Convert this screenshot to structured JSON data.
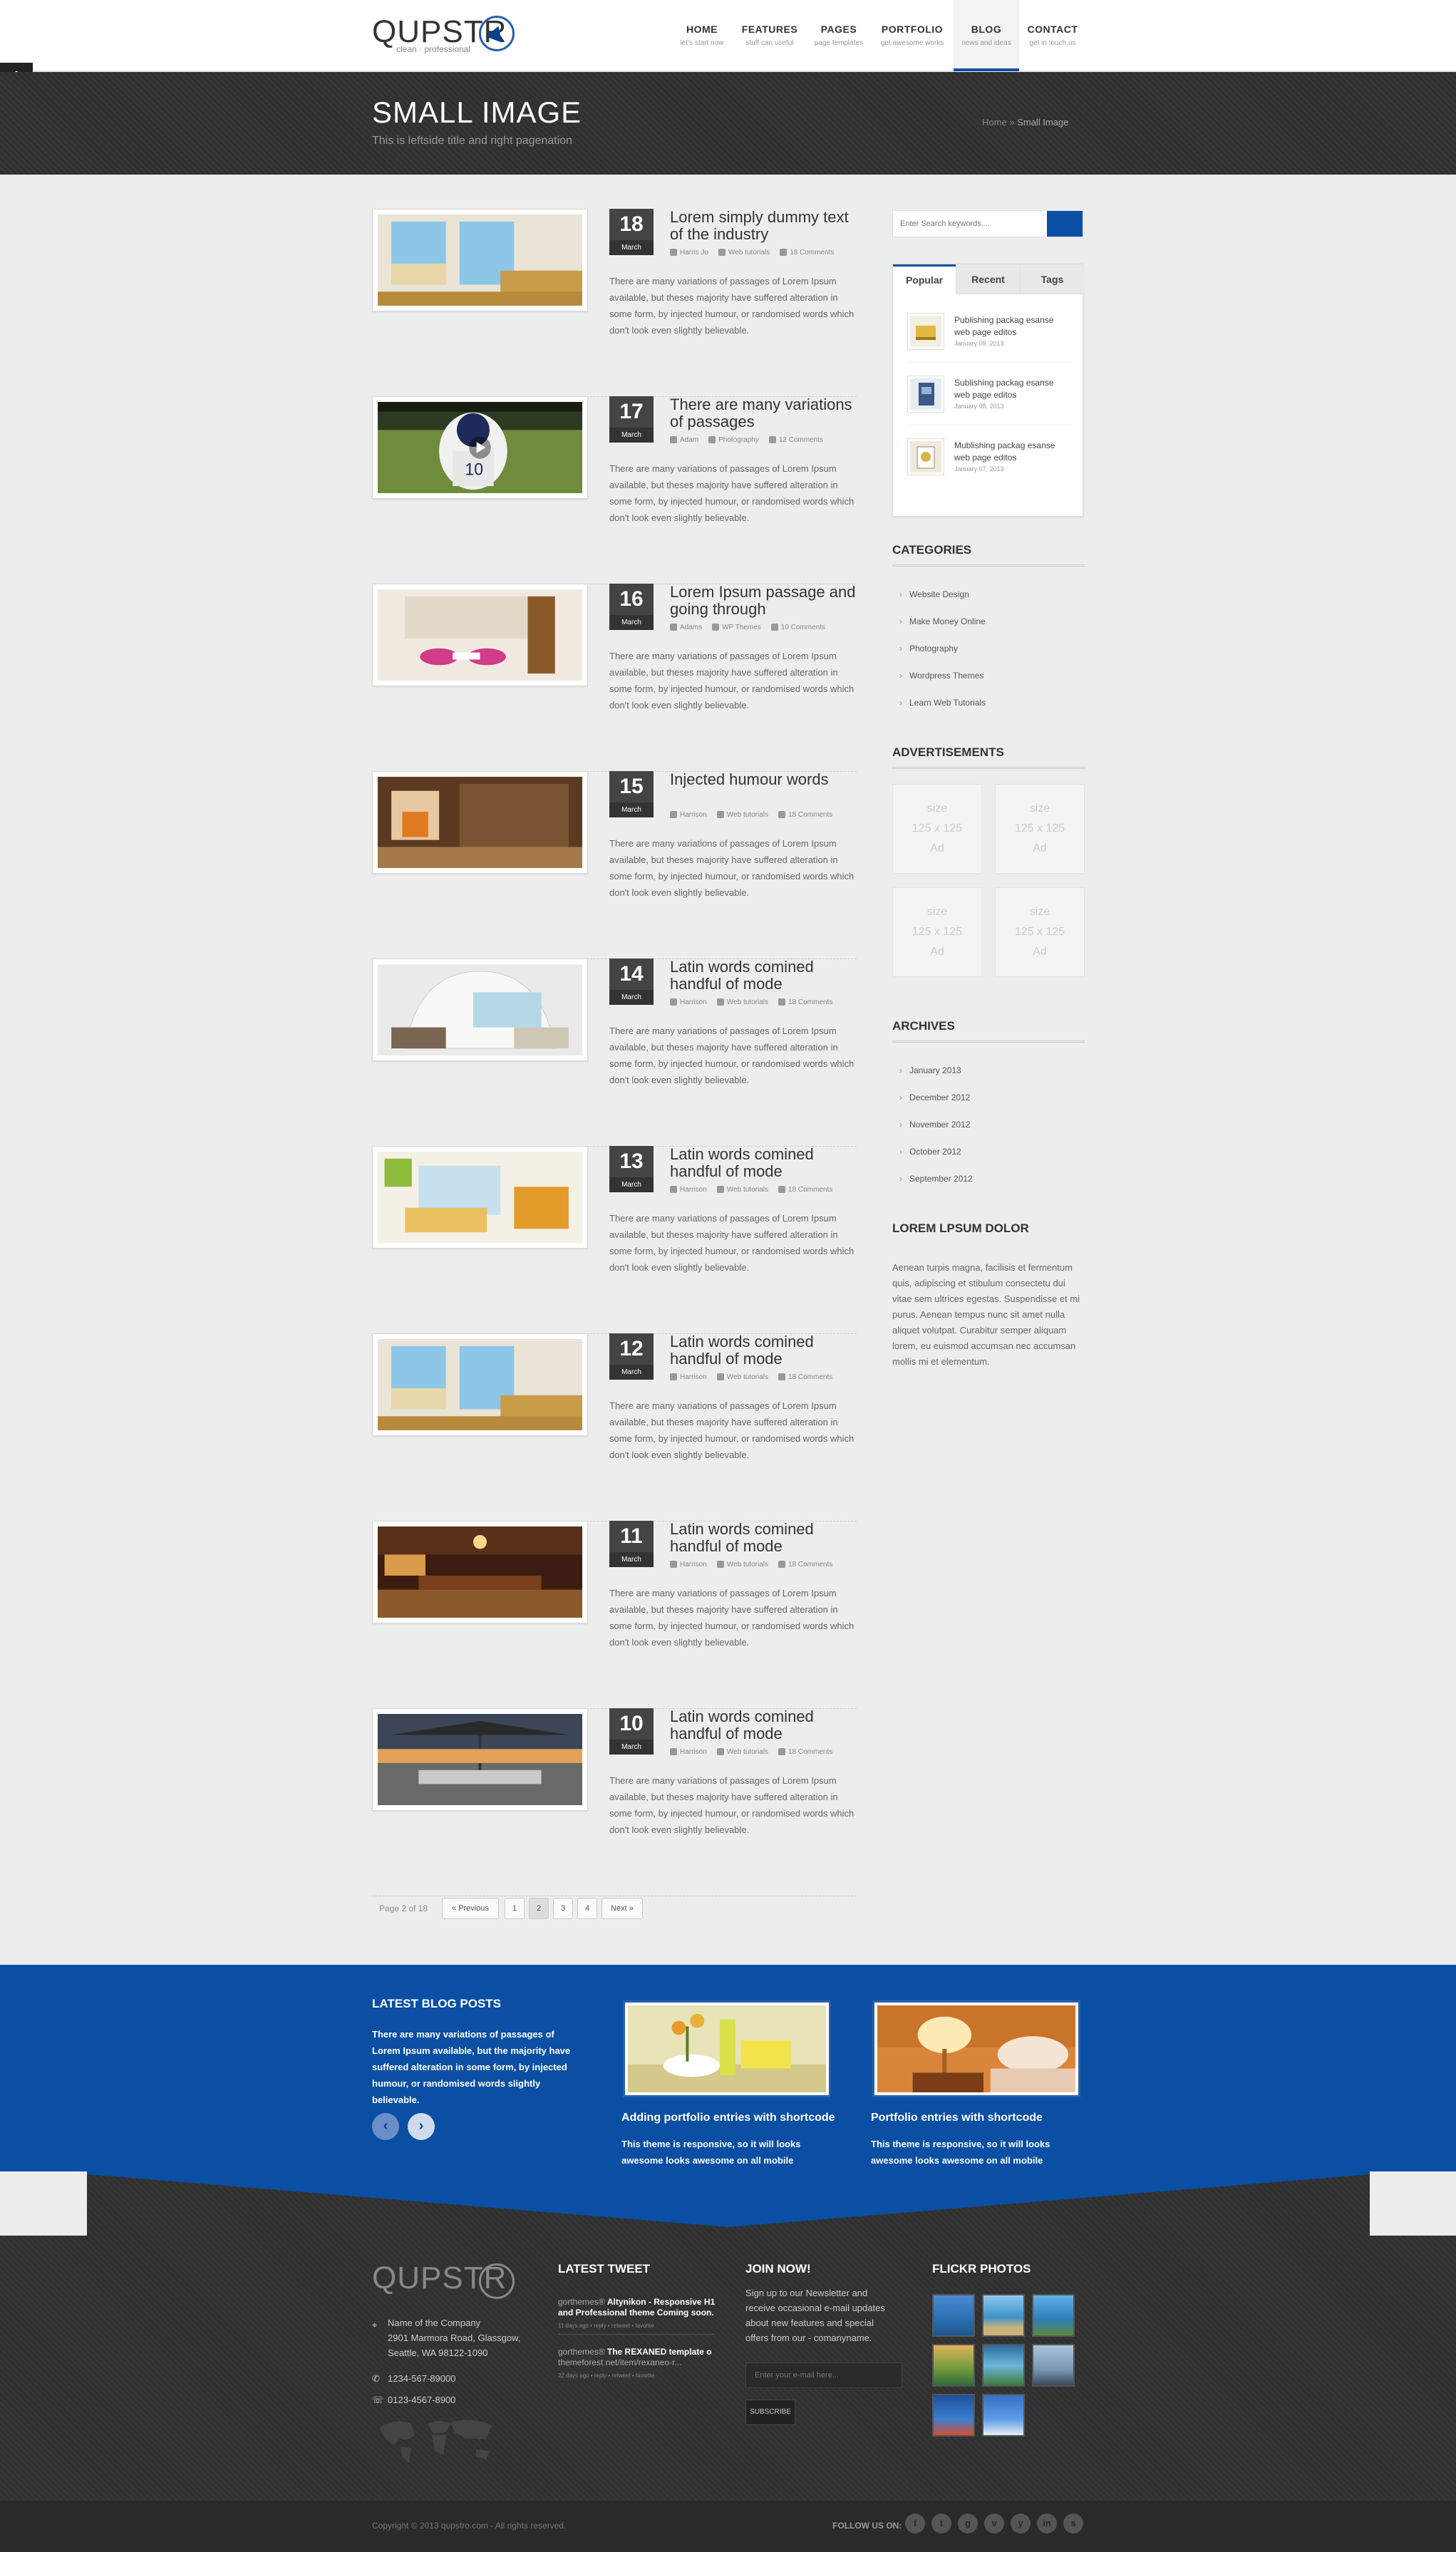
{
  "header": {
    "logo_word": "QUPSTR",
    "logo_tagline": "clean · professional",
    "nav": [
      {
        "label": "HOME",
        "sub": "let's start now"
      },
      {
        "label": "FEATURES",
        "sub": "stuff can useful"
      },
      {
        "label": "PAGES",
        "sub": "page templates"
      },
      {
        "label": "PORTFOLIO",
        "sub": "get awesome works"
      },
      {
        "label": "BLOG",
        "sub": "news and ideas"
      },
      {
        "label": "CONTACT",
        "sub": "get in touch us"
      }
    ],
    "active_nav": "BLOG"
  },
  "titlebar": {
    "title": "SMALL IMAGE",
    "subtitle": "This is leftside title and right pagenation",
    "breadcrumb_home": "Home",
    "breadcrumb_sep": "»",
    "breadcrumb_current": "Small Image"
  },
  "posts": [
    {
      "day": "18",
      "month": "March",
      "title": "Lorem simply dummy text of the industry",
      "author": "Harris Jo",
      "category": "Web tutorials",
      "comments": "18 Comments",
      "excerpt": "There are many variations of passages of Lorem Ipsum available, but theses majority have suffered alteration in some form, by injected humour, or randomised words which don't look even slightly believable."
    },
    {
      "day": "17",
      "month": "March",
      "title": "There are many variations of passages",
      "author": "Adam",
      "category": "Photography",
      "comments": "12 Comments",
      "excerpt": "There are many variations of passages of Lorem Ipsum available, but theses majority have suffered alteration in some form, by injected humour, or randomised words which don't look even slightly believable."
    },
    {
      "day": "16",
      "month": "March",
      "title": "Lorem Ipsum passage and going through",
      "author": "Adams",
      "category": "WP Themes",
      "comments": "10 Comments",
      "excerpt": "There are many variations of passages of Lorem Ipsum available, but theses majority have suffered alteration in some form, by injected humour, or randomised words which don't look even slightly believable."
    },
    {
      "day": "15",
      "month": "March",
      "title": "Injected humour words",
      "author": "Harrison",
      "category": "Web tutorials",
      "comments": "18 Comments",
      "excerpt": "There are many variations of passages of Lorem Ipsum available, but theses majority have suffered alteration in some form, by injected humour, or randomised words which don't look even slightly believable."
    },
    {
      "day": "14",
      "month": "March",
      "title": "Latin words comined handful of mode",
      "author": "Harrison",
      "category": "Web tutorials",
      "comments": "18 Comments",
      "excerpt": "There are many variations of passages of Lorem Ipsum available, but theses majority have suffered alteration in some form, by injected humour, or randomised words which don't look even slightly believable."
    },
    {
      "day": "13",
      "month": "March",
      "title": "Latin words comined handful of mode",
      "author": "Harrison",
      "category": "Web tutorials",
      "comments": "18 Comments",
      "excerpt": "There are many variations of passages of Lorem Ipsum available, but theses majority have suffered alteration in some form, by injected humour, or randomised words which don't look even slightly believable."
    },
    {
      "day": "12",
      "month": "March",
      "title": "Latin words comined handful of mode",
      "author": "Harrison",
      "category": "Web tutorials",
      "comments": "18 Comments",
      "excerpt": "There are many variations of passages of Lorem Ipsum available, but theses majority have suffered alteration in some form, by injected humour, or randomised words which don't look even slightly believable."
    },
    {
      "day": "11",
      "month": "March",
      "title": "Latin words comined handful of mode",
      "author": "Harrison",
      "category": "Web tutorials",
      "comments": "18 Comments",
      "excerpt": "There are many variations of passages of Lorem Ipsum available, but theses majority have suffered alteration in some form, by injected humour, or randomised words which don't look even slightly believable."
    },
    {
      "day": "10",
      "month": "March",
      "title": "Latin words comined handful of mode",
      "author": "Harrison",
      "category": "Web tutorials",
      "comments": "18 Comments",
      "excerpt": "There are many variations of passages of Lorem Ipsum available, but theses majority have suffered alteration in some form, by injected humour, or randomised words which don't look even slightly believable."
    }
  ],
  "pagination": {
    "info": "Page 2 of 18",
    "prev": "« Previous",
    "pages": [
      "1",
      "2",
      "3",
      "4"
    ],
    "current": "2",
    "next": "Next »"
  },
  "sidebar": {
    "search_placeholder": "Enter Search keywords....",
    "tabs": [
      "Popular",
      "Recent",
      "Tags"
    ],
    "tab_items": [
      {
        "title": "Publishing packag esanse web page editos",
        "date": "January 09, 2013"
      },
      {
        "title": "Sublishing packag esanse web page editos",
        "date": "January 08, 2013"
      },
      {
        "title": "Mublishing packag esanse web page editos",
        "date": "January 07, 2013"
      }
    ],
    "categories_title": "CATEGORIES",
    "categories": [
      "Website Design",
      "Make Money Online",
      "Photography",
      "Wordpress Themes",
      "Learn Web Tutorials"
    ],
    "ads_title": "ADVERTISEMENTS",
    "ad_label_1": "size",
    "ad_label_2": "125 x 125",
    "ad_label_3": "Ad",
    "archives_title": "ARCHIVES",
    "archives": [
      "January 2013",
      "December 2012",
      "November 2012",
      "October 2012",
      "September 2012"
    ],
    "lorem_title": "LOREM LPSUM DOLOR",
    "lorem_text": "Aenean turpis magna, facilisis et fermentum quis, adipiscing et stibulum consectetu dui vitae sem ultrices egestas. Suspendisse et mi purus. Aenean tempus nunc sit amet nulla aliquet volutpat. Curabitur semper aliquam lorem, eu euismod accumsan nec accumsan mollis mi et elementum."
  },
  "latest": {
    "title": "LATEST BLOG POSTS",
    "text": "There are many variations of passages of Lorem Ipsum available, but the majority have suffered alteration in some form, by injected humour, or randomised words slightly believable.",
    "prev_symbol": "‹",
    "next_symbol": "›",
    "items": [
      {
        "title": "Adding portfolio entries with shortcode",
        "text": "This theme is responsive, so it will looks awesome looks awesome on all mobile devices."
      },
      {
        "title": "Portfolio entries with shortcode",
        "text": "This theme is responsive, so it will looks awesome looks awesome on all mobile devices."
      }
    ]
  },
  "footer": {
    "company": [
      "Name of the Company",
      "2901 Marmora Road, Glassgow,",
      "Seattle, WA 98122-1090"
    ],
    "phone": "1234-567-89000",
    "fax": "0123-4567-8900",
    "tweet_title": "LATEST TWEET",
    "tweets": [
      {
        "user": "gorthemes®",
        "bold": "Altynikon - Responsive H1 and Professional theme Coming soon.",
        "meta": "11 days ago • reply • retweet • favorite"
      },
      {
        "user": "gorthemes®",
        "bold": "The REXANED template o",
        "link": "themeforest.net/item/rexaneo-r...",
        "meta": "22 days ago • reply • retweet • favorite"
      }
    ],
    "join_title": "JOIN NOW!",
    "join_text": "Sign up to our Newsletter and receive occasional e-mail updates about new features and special offers from our - comanyname.",
    "email_placeholder": "Enter your e-mail here...",
    "subscribe": "SUBSCRIBE",
    "flickr_title": "FLICKR PHOTOS",
    "copyright": "Copyright © 2013 qupstro.com - All rights reserved.",
    "follow": "FOLLOW US ON:",
    "social": [
      "f",
      "t",
      "g",
      "v",
      "y",
      "in",
      "s"
    ]
  }
}
